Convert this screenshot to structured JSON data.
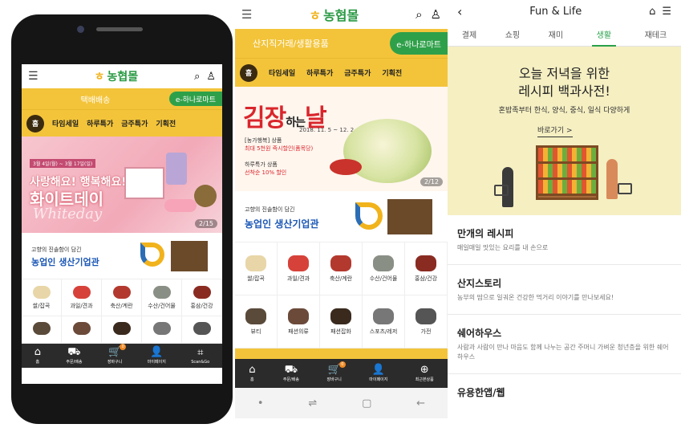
{
  "screen1": {
    "logo": "농협몰",
    "delivery_band": "택배배송",
    "hanaro_tab": "e-하나로마트",
    "home_tab": "홈",
    "nav": [
      "타임세일",
      "하루특가",
      "금주특가",
      "기획전"
    ],
    "banner": {
      "date": "3월 4일(월) ~ 3월 17일(일)",
      "line1": "사랑해요! 행복해요!",
      "line2": "화이트데이",
      "line3": "Whiteday",
      "counter": "2/15"
    },
    "promo": {
      "small": "고향의 진솔함이 담긴",
      "main": "농업인 생산기업관"
    },
    "categories": [
      "쌀/잡곡",
      "과일/견과",
      "축산/계란",
      "수산/건어물",
      "홍삼/건강",
      "",
      "",
      "",
      "",
      ""
    ],
    "bottom_nav": [
      {
        "icon": "⌂",
        "label": "홈"
      },
      {
        "icon": "⛟",
        "label": "주문/배송"
      },
      {
        "icon": "🛒",
        "label": "장바구니",
        "badge": "0"
      },
      {
        "icon": "👤",
        "label": "마이페이지"
      },
      {
        "icon": "⌗",
        "label": "Scan&Go"
      }
    ]
  },
  "screen2": {
    "logo": "농협몰",
    "band": "산지직거래/생활용품",
    "hanaro_tab": "e-하나로마트",
    "home_tab": "홈",
    "nav": [
      "타임세일",
      "하루특가",
      "금주특가",
      "기획전"
    ],
    "banner": {
      "title": "김장",
      "title_small": "하는",
      "title_end": "날",
      "date": "2018. 11. 5 ~ 12. 2",
      "line1": "[농가행복] 상품",
      "line2": "최대 5천원 즉시할인(품목당)",
      "line3": "하루특가 상품",
      "line4": "선착순 10% 할인",
      "counter": "2/12"
    },
    "promo": {
      "small": "고향의 진솔함이 담긴",
      "main": "농업인 생산기업관"
    },
    "categories": [
      "쌀/잡곡",
      "과일/견과",
      "축산/계란",
      "수산/건어물",
      "홍삼/건강",
      "뷰티",
      "패션의류",
      "패션잡화",
      "스포츠/레저",
      "가전"
    ],
    "bottom_nav": [
      {
        "icon": "⌂",
        "label": "홈"
      },
      {
        "icon": "⛟",
        "label": "주문/배송"
      },
      {
        "icon": "🛒",
        "label": "장바구니",
        "badge": "0"
      },
      {
        "icon": "👤",
        "label": "마이페이지"
      },
      {
        "icon": "⊕",
        "label": "최근본상품"
      }
    ],
    "sysbar": [
      "•",
      "⇌",
      "▢",
      "←"
    ]
  },
  "screen3": {
    "title": "Fun & Life",
    "tabs": [
      "결제",
      "쇼핑",
      "재미",
      "생활",
      "재테크"
    ],
    "active_tab": "생활",
    "hero": {
      "line1": "오늘 저녁을 위한",
      "line2": "레시피 백과사전!",
      "sub": "혼밥족부터 한식, 양식, 중식, 일식 다양하게",
      "go": "바로가기 >"
    },
    "items": [
      {
        "title": "만개의 레시피",
        "desc": "매일매일 맛있는 요리를 내 손으로"
      },
      {
        "title": "산지스토리",
        "desc": "농부의 땀으로 일궈온 건강한 먹거리 이야기를 만나보세요!"
      },
      {
        "title": "쉐어하우스",
        "desc": "사람과 사람이 만나 마음도 함께 나누는 공간 주머니 가벼운 청년층을 위한 쉐어하우스"
      },
      {
        "title": "유용한앱/웹",
        "desc": ""
      }
    ]
  },
  "colors": {
    "yellow": "#f3c43a",
    "green": "#2fa04a",
    "dark": "#2b2b2b"
  }
}
